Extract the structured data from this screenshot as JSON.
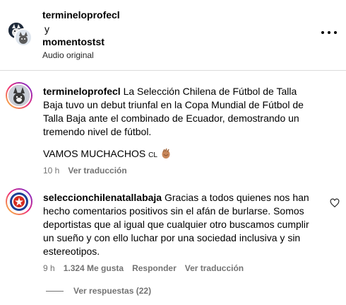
{
  "header": {
    "user1": "termineloprofecl",
    "conjunction": "y",
    "user2": "momentostst",
    "subtitle": "Audio original"
  },
  "comments": [
    {
      "username": "termineloprofecl",
      "text": "La Selección Chilena de Fútbol de Talla Baja tuvo un debut triunfal en la Copa Mundial de Fútbol de Talla Baja ante el combinado de Ecuador, demostrando un tremendo nivel de fútbol.",
      "text2": "VAMOS MUCHACHOS",
      "text2_suffix": "CL",
      "time": "10 h",
      "translate": "Ver traducción"
    },
    {
      "username": "seleccionchilenatallabaja",
      "text": "Gracias a todos quienes nos han hecho comentarios positivos sin el afán de burlarse. Somos deportistas que al igual que cualquier otro buscamos cumplir un sueño y con ello luchar por una sociedad inclusiva y sin estereotipos.",
      "time": "9 h",
      "likes": "1.324 Me gusta",
      "reply": "Responder",
      "translate": "Ver traducción",
      "view_replies": "Ver respuestas (22)"
    }
  ],
  "colors": {
    "secondary_text": "#737373",
    "divider": "#dbdbdb"
  },
  "icons": [
    "more-options-icon",
    "heart-icon",
    "clapping-hands-icon"
  ]
}
